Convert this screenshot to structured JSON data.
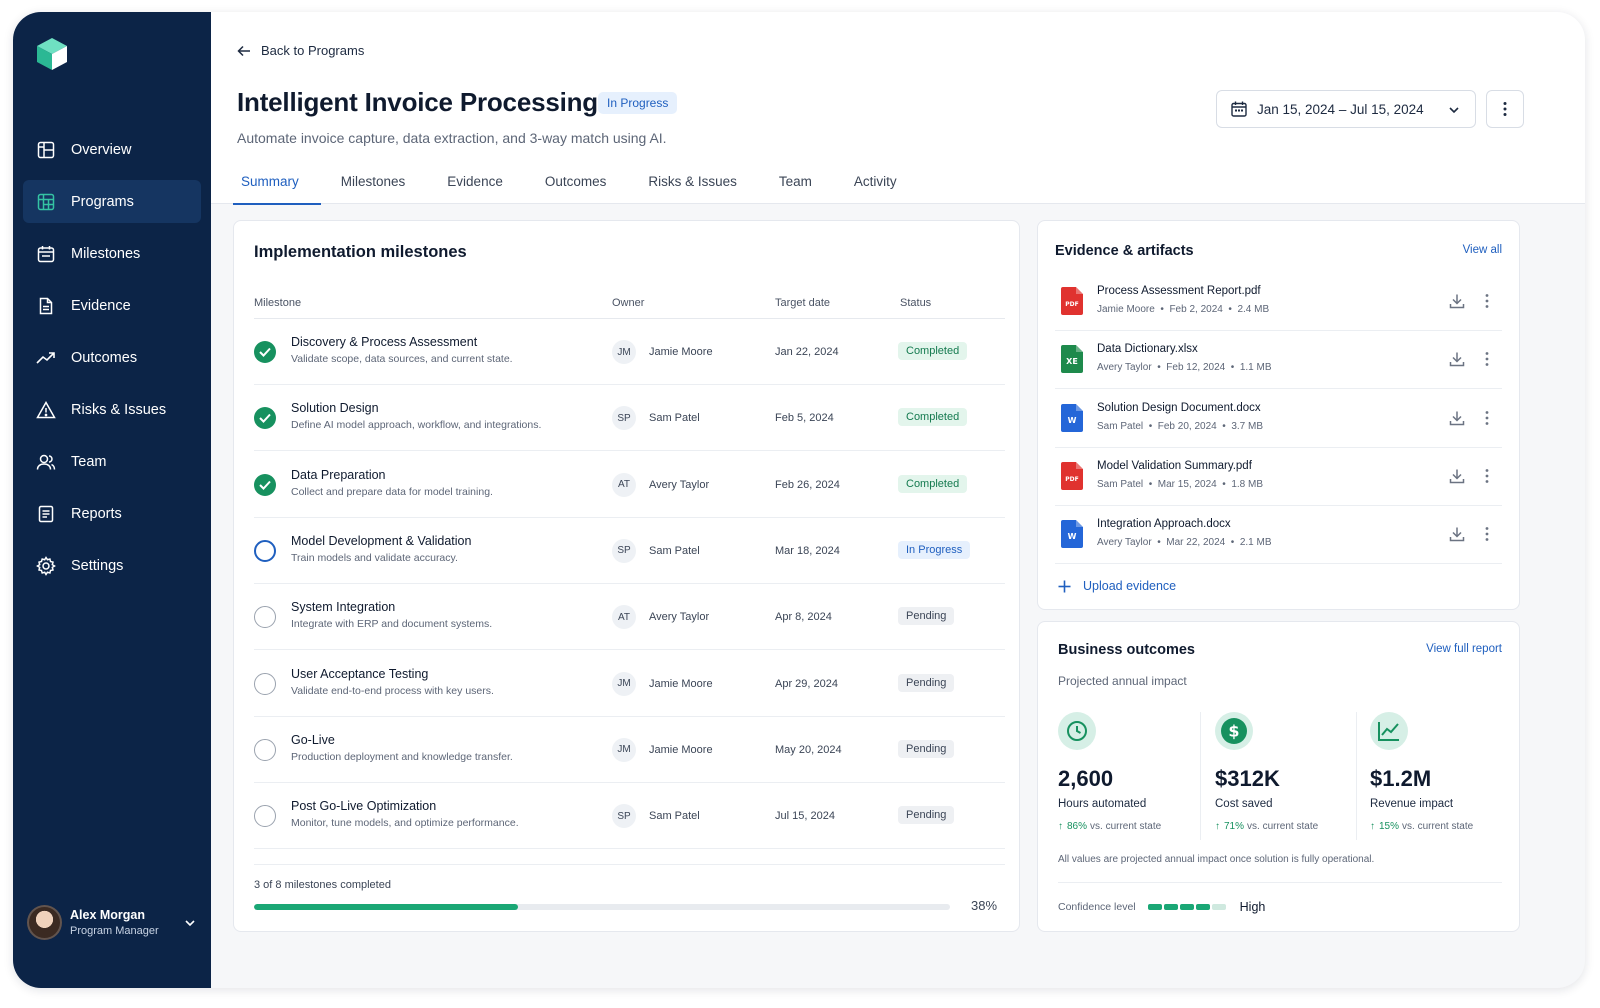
{
  "sidebar": {
    "items": [
      {
        "label": "Overview",
        "icon": "overview-icon",
        "active": false
      },
      {
        "label": "Programs",
        "icon": "programs-icon",
        "active": true
      },
      {
        "label": "Milestones",
        "icon": "calendar-icon",
        "active": false
      },
      {
        "label": "Evidence",
        "icon": "document-icon",
        "active": false
      },
      {
        "label": "Outcomes",
        "icon": "trend-icon",
        "active": false
      },
      {
        "label": "Risks & Issues",
        "icon": "warning-icon",
        "active": false
      },
      {
        "label": "Team",
        "icon": "team-icon",
        "active": false
      },
      {
        "label": "Reports",
        "icon": "reports-icon",
        "active": false
      },
      {
        "label": "Settings",
        "icon": "gear-icon",
        "active": false
      }
    ],
    "user": {
      "name": "Alex Morgan",
      "role": "Program Manager"
    }
  },
  "header": {
    "back_label": "Back to Programs",
    "title": "Intelligent Invoice Processing",
    "status": "In Progress",
    "subtitle": "Automate invoice capture, data extraction, and 3-way match using AI.",
    "date_range": "Jan 15, 2024 – Jul 15, 2024"
  },
  "tabs": [
    {
      "label": "Summary",
      "active": true
    },
    {
      "label": "Milestones"
    },
    {
      "label": "Evidence"
    },
    {
      "label": "Outcomes"
    },
    {
      "label": "Risks & Issues"
    },
    {
      "label": "Team"
    },
    {
      "label": "Activity"
    }
  ],
  "milestones": {
    "title": "Implementation milestones",
    "columns": {
      "milestone": "Milestone",
      "owner": "Owner",
      "target": "Target date",
      "status": "Status"
    },
    "rows": [
      {
        "name": "Discovery & Process Assessment",
        "desc": "Validate scope, data sources, and current state.",
        "initials": "JM",
        "owner": "Jamie Moore",
        "date": "Jan 22, 2024",
        "status": "Completed",
        "state": "done"
      },
      {
        "name": "Solution Design",
        "desc": "Define AI model approach, workflow, and integrations.",
        "initials": "SP",
        "owner": "Sam Patel",
        "date": "Feb 5, 2024",
        "status": "Completed",
        "state": "done"
      },
      {
        "name": "Data Preparation",
        "desc": "Collect and prepare data for model training.",
        "initials": "AT",
        "owner": "Avery Taylor",
        "date": "Feb 26, 2024",
        "status": "Completed",
        "state": "done"
      },
      {
        "name": "Model Development & Validation",
        "desc": "Train models and validate accuracy.",
        "initials": "SP",
        "owner": "Sam Patel",
        "date": "Mar 18, 2024",
        "status": "In Progress",
        "state": "progress"
      },
      {
        "name": "System Integration",
        "desc": "Integrate with ERP and document systems.",
        "initials": "AT",
        "owner": "Avery Taylor",
        "date": "Apr 8, 2024",
        "status": "Pending",
        "state": "pending"
      },
      {
        "name": "User Acceptance Testing",
        "desc": "Validate end-to-end process with key users.",
        "initials": "JM",
        "owner": "Jamie Moore",
        "date": "Apr 29, 2024",
        "status": "Pending",
        "state": "pending"
      },
      {
        "name": "Go-Live",
        "desc": "Production deployment and knowledge transfer.",
        "initials": "JM",
        "owner": "Jamie Moore",
        "date": "May 20, 2024",
        "status": "Pending",
        "state": "pending"
      },
      {
        "name": "Post Go-Live Optimization",
        "desc": "Monitor, tune models, and optimize performance.",
        "initials": "SP",
        "owner": "Sam Patel",
        "date": "Jul 15, 2024",
        "status": "Pending",
        "state": "pending"
      }
    ],
    "summary": "3 of 8 milestones completed",
    "progress_label": "38%",
    "progress_fraction": 0.38
  },
  "evidence": {
    "title": "Evidence & artifacts",
    "view_all": "View all",
    "files": [
      {
        "name": "Process Assessment Report.pdf",
        "owner": "Jamie Moore",
        "date": "Feb 2, 2024",
        "size": "2.4 MB",
        "type": "pdf",
        "icon_label": "PDF",
        "color": "#e0322f"
      },
      {
        "name": "Data Dictionary.xlsx",
        "owner": "Avery Taylor",
        "date": "Feb 12, 2024",
        "size": "1.1 MB",
        "type": "xlsx",
        "icon_label": "XE",
        "color": "#1e8a4c"
      },
      {
        "name": "Solution Design Document.docx",
        "owner": "Sam Patel",
        "date": "Feb 20, 2024",
        "size": "3.7 MB",
        "type": "docx",
        "icon_label": "W",
        "color": "#2466d8"
      },
      {
        "name": "Model Validation Summary.pdf",
        "owner": "Sam Patel",
        "date": "Mar 15, 2024",
        "size": "1.8 MB",
        "type": "pdf",
        "icon_label": "PDF",
        "color": "#e0322f"
      },
      {
        "name": "Integration Approach.docx",
        "owner": "Avery Taylor",
        "date": "Mar 22, 2024",
        "size": "2.1 MB",
        "type": "docx",
        "icon_label": "W",
        "color": "#2466d8"
      }
    ],
    "upload_label": "Upload evidence"
  },
  "outcomes": {
    "title": "Business outcomes",
    "view_report": "View full report",
    "subtitle": "Projected annual impact",
    "kpis": [
      {
        "value": "2,600",
        "label": "Hours automated",
        "delta": "86%",
        "delta_text": "vs. current state",
        "icon": "clock-icon"
      },
      {
        "value": "$312K",
        "label": "Cost saved",
        "delta": "71%",
        "delta_text": "vs. current state",
        "icon": "dollar-icon"
      },
      {
        "value": "$1.2M",
        "label": "Revenue impact",
        "delta": "15%",
        "delta_text": "vs. current state",
        "icon": "chart-line-icon"
      }
    ],
    "note": "All values are projected annual impact once solution is fully operational.",
    "confidence_label": "Confidence level",
    "confidence_value": "High",
    "confidence_level": 4,
    "confidence_max": 5
  },
  "colors": {
    "sidebar": "#0c2447",
    "accent": "#1f5fbf",
    "success": "#17915f",
    "progress": "#1aa775"
  }
}
